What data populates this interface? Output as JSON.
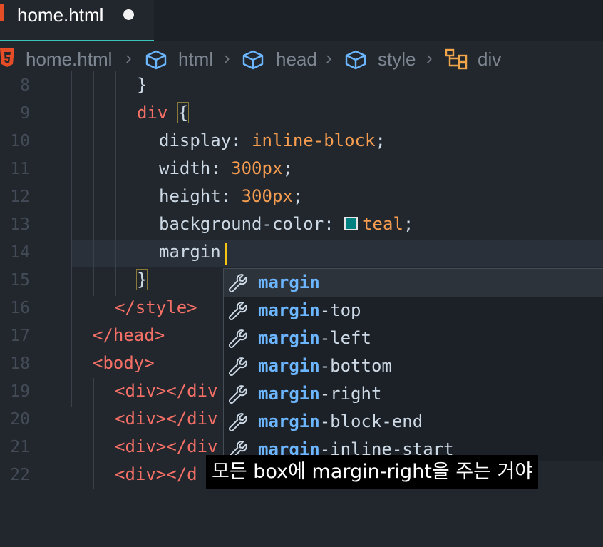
{
  "tab": {
    "title": "home.html",
    "dirty_icon": "unsaved-dot-icon"
  },
  "breadcrumb": {
    "items": [
      "home.html",
      "html",
      "head",
      "style",
      "div"
    ],
    "icons": [
      "html5-icon",
      "cube-icon",
      "cube-icon",
      "cube-icon",
      "element-tree-icon"
    ]
  },
  "editor": {
    "line_numbers": [
      "8",
      "9",
      "10",
      "11",
      "12",
      "13",
      "14",
      "15",
      "16",
      "17",
      "18",
      "19",
      "20",
      "21",
      "22"
    ],
    "lines": {
      "l8": "}",
      "l9_sel": "div",
      "l9_brace": "{",
      "l10_prop": "display",
      "l10_val": "inline-block",
      "l11_prop": "width",
      "l11_val": "300px",
      "l12_prop": "height",
      "l12_val": "300px",
      "l13_prop": "background-color",
      "l13_val": "teal",
      "l13_swatch_color": "#008080",
      "l14_typed": "margin",
      "l15": "}",
      "l16": "</style>",
      "l17": "</head>",
      "l18": "<body>",
      "l19": "<div></div",
      "l20": "<div></div",
      "l21": "<div></div",
      "l22": "<div></d"
    }
  },
  "suggestions": {
    "typed": "margin",
    "items": [
      {
        "match": "margin",
        "rest": ""
      },
      {
        "match": "margin",
        "rest": "-top"
      },
      {
        "match": "margin",
        "rest": "-left"
      },
      {
        "match": "margin",
        "rest": "-bottom"
      },
      {
        "match": "margin",
        "rest": "-right"
      },
      {
        "match": "margin",
        "rest": "-block-end"
      },
      {
        "match": "margin",
        "rest": "-inline-start"
      }
    ],
    "icon": "wrench-icon"
  },
  "subtitle": "모든 box에 margin-right을 주는 거야",
  "colors": {
    "accent": "#39c5bb",
    "tag": "#f47067",
    "value": "#f69d50",
    "match": "#6cb6ff",
    "cursor": "#f9c513"
  }
}
